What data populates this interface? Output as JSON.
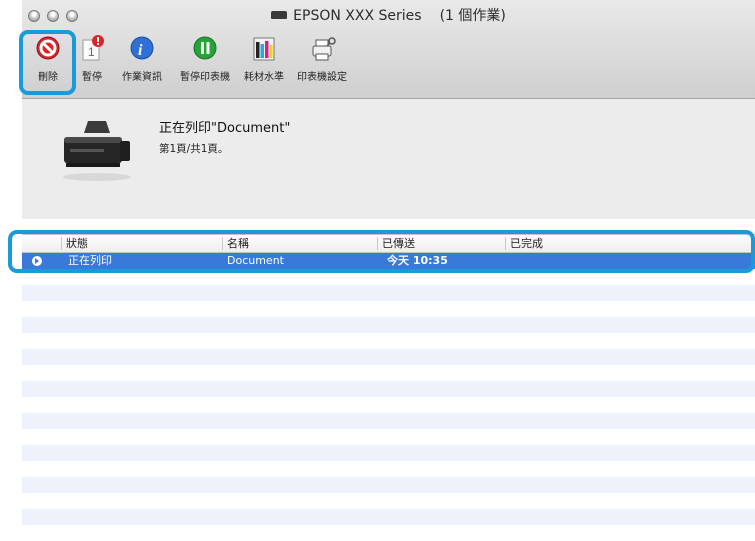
{
  "window": {
    "title": "EPSON XXX Series",
    "job_count": "(1 個作業)"
  },
  "toolbar": {
    "items": [
      {
        "label": "刪除",
        "icon": "delete-icon"
      },
      {
        "label": "暫停",
        "icon": "pause-job-icon",
        "badge": "1"
      },
      {
        "label": "作業資訊",
        "icon": "info-icon"
      },
      {
        "label": "暫停印表機",
        "icon": "pause-printer-icon"
      },
      {
        "label": "耗材水準",
        "icon": "supply-levels-icon"
      },
      {
        "label": "印表機設定",
        "icon": "printer-settings-icon"
      }
    ]
  },
  "job": {
    "title": "正在列印\"Document\"",
    "page": "第1頁/共1頁。"
  },
  "table": {
    "columns": [
      "狀態",
      "名稱",
      "已傳送",
      "已完成"
    ],
    "rows": [
      {
        "status": "正在列印",
        "name": "Document",
        "sent": "今天 10:35",
        "completed": ""
      }
    ]
  },
  "colors": {
    "highlight": "#1a9ad8",
    "selection": "#3879d9",
    "delete_red": "#d8262c",
    "info_blue": "#2f6fd6",
    "pause_green": "#27a338"
  }
}
